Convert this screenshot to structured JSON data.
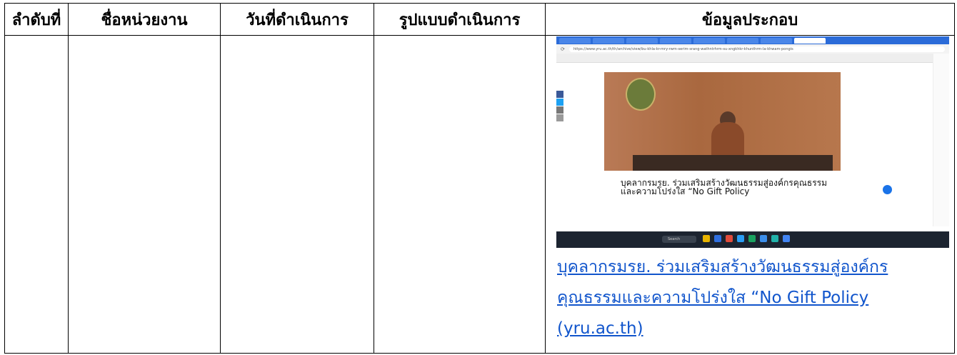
{
  "table": {
    "headers": [
      "ลำดับที่",
      "ชื่อหน่วยงาน",
      "วันที่ดำเนินการ",
      "รูปแบบดำเนินการ",
      "ข้อมูลประกอบ"
    ]
  },
  "screenshot": {
    "url": "https://www.yru.ac.th/th/archive/view/bu-khla-kr-mry-rwm-serim-srang-wathntrhrm-su-xngkhkr-khunthrm-la-khwam-pongis",
    "article_title": "บุคลากรมรย. ร่วมเสริมสร้างวัฒนธรรมสู่องค์กรคุณธรรมและความโปร่งใส “No Gift Policy",
    "taskbar_search": "Search",
    "icons": [
      "facebook-icon",
      "twitter-icon",
      "mail-icon",
      "share-icon",
      "search-icon"
    ]
  },
  "link": {
    "text": "บุคลากรมรย. ร่วมเสริมสร้างวัฒนธรรมสู่องค์กรคุณธรรมและความโปร่งใส “No Gift Policy (yru.ac.th)"
  }
}
